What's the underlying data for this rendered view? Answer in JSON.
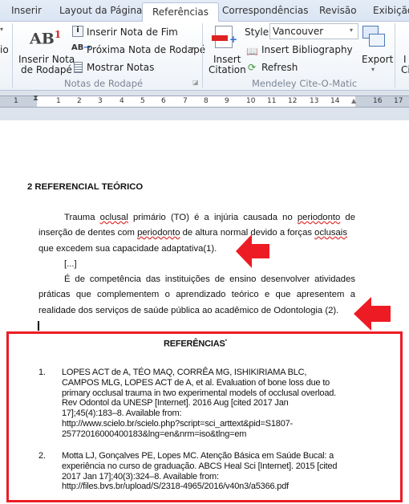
{
  "tabs": [
    "Inserir",
    "Layout da Página",
    "Referências",
    "Correspondências",
    "Revisão",
    "Exibição"
  ],
  "active_tab": "Referências",
  "ribbon": {
    "left_cut_label": "io",
    "footnotes": {
      "insert_footnote_line1": "Inserir Nota",
      "insert_footnote_line2": "de Rodapé",
      "insert_endnote": "Inserir Nota de Fim",
      "next_footnote": "Próxima Nota de Rodapé",
      "show_notes": "Mostrar Notas",
      "group_label": "Notas de Rodapé"
    },
    "mendeley": {
      "insert_citation_line1": "Insert",
      "insert_citation_line2": "Citation",
      "style_label": "Style:",
      "style_value": "Vancouver",
      "insert_bibliography": "Insert Bibliography",
      "refresh": "Refresh",
      "export": "Export",
      "group_label": "Mendeley Cite-O-Matic"
    },
    "right_cut_label1": "I",
    "right_cut_label2": "Ci"
  },
  "ruler": {
    "ticks": [
      "1",
      "1",
      "2",
      "3",
      "4",
      "5",
      "6",
      "7",
      "8",
      "9",
      "10",
      "11",
      "12",
      "13",
      "14",
      "16",
      "17"
    ]
  },
  "document": {
    "heading": "2  REFERENCIAL  TEÓRICO",
    "p1": {
      "l1a": "Trauma ",
      "l1b": "oclusal",
      "l1c": " primário (TO) é a injúria causada no ",
      "l1d": "periodonto",
      "l1e": " de",
      "l2a": "inserção de dentes com ",
      "l2b": "periodonto",
      "l2c": " de altura normal devido a forças ",
      "l2d": "oclusais",
      "l3": "que excedem sua capacidade adaptativa(1)."
    },
    "ellipsis": "[...]",
    "p2": {
      "l1": "É de competência das instituições de ensino desenvolver atividades",
      "l2": "práticas que complementem o aprendizado teórico e que apresentem a",
      "l3": "realidade dos serviços de saúde pública ao acadêmico de Odontologia (2)."
    },
    "references_title": "REFERÊNCIAS",
    "references_mark": "*",
    "references": [
      {
        "num": "1.",
        "lines": [
          "LOPES ACT de A, TÉO MAQ, CORRÊA MG, ISHIKIRIAMA BLC,",
          "CAMPOS MLG, LOPES ACT de A, et al. Evaluation of bone loss due to",
          "primary occlusal trauma in two experimental models of occlusal overload.",
          "Rev Odontol da UNESP [Internet]. 2016 Aug [cited 2017 Jan",
          "17];45(4):183–8.  Available from:",
          "http://www.scielo.br/scielo.php?script=sci_arttext&pid=S1807-",
          "25772016000400183&lng=en&nrm=iso&tlng=em"
        ]
      },
      {
        "num": "2.",
        "lines": [
          "Motta LJ, Gonçalves PE, Lopes MC. Atenção Básica em Saúde Bucal: a",
          "experiência no curso de graduação. ABCS Heal Sci [Internet]. 2015 [cited",
          "2017 Jan 17];40(3):324–8.  Available from:",
          "http://files.bvs.br/upload/S/2318-4965/2016/v40n3/a5366.pdf"
        ]
      }
    ]
  },
  "colors": {
    "annotation_red": "#ed1c24",
    "spellcheck": "#e03030",
    "ribbon_border": "#b6c4d8"
  }
}
